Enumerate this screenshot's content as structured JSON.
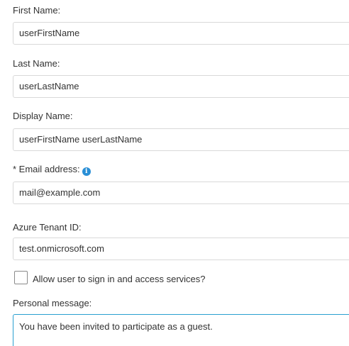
{
  "first_name": {
    "label": "First Name:",
    "value": "userFirstName"
  },
  "last_name": {
    "label": "Last Name:",
    "value": "userLastName"
  },
  "display_name": {
    "label": "Display Name:",
    "value": "userFirstName userLastName"
  },
  "email": {
    "label": "* Email address:",
    "value": "mail@example.com",
    "info_icon": "info-icon",
    "info_glyph": "i"
  },
  "tenant": {
    "label": "Azure Tenant ID:",
    "value": "test.onmicrosoft.com"
  },
  "allow_signin": {
    "label": "Allow user to sign in and access services?",
    "checked": false
  },
  "personal_message": {
    "label": "Personal message:",
    "value": "You have been invited to participate as a guest."
  },
  "colors": {
    "info_icon": "#2a8fd6",
    "focus_border": "#2a9fd0",
    "field_border": "#d9d9d9"
  }
}
